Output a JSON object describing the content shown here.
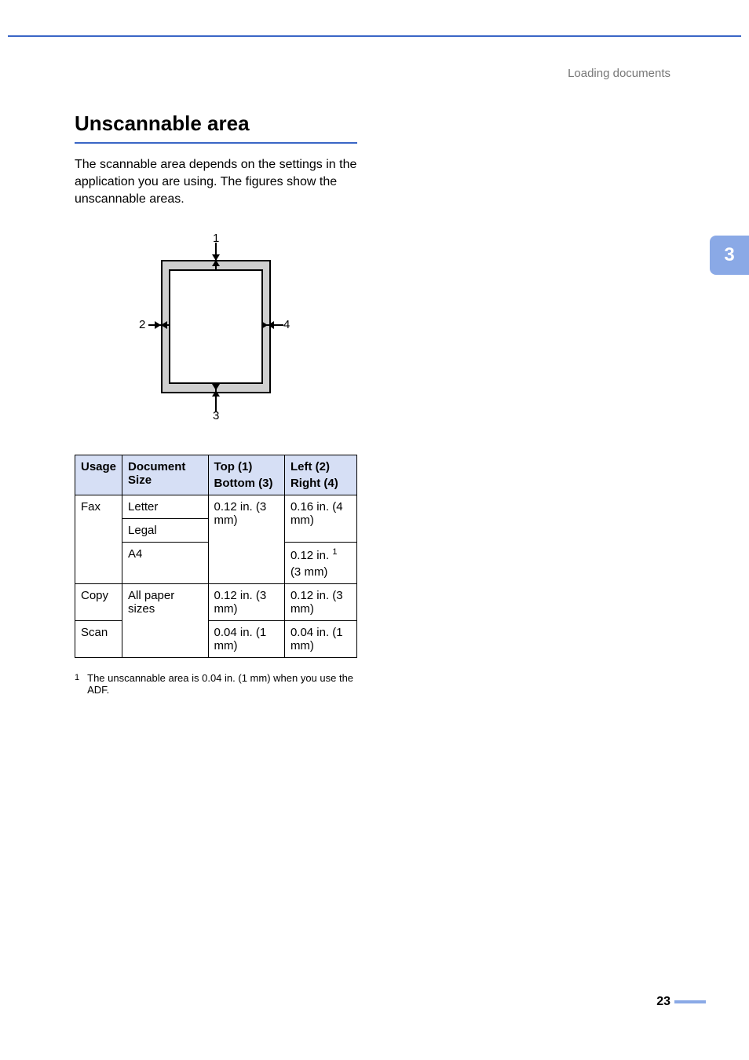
{
  "breadcrumb": "Loading documents",
  "tab_number": "3",
  "heading": "Unscannable area",
  "intro": "The scannable area depends on the settings in the application you are using. The figures show the unscannable areas.",
  "diagram": {
    "label1": "1",
    "label2": "2",
    "label3": "3",
    "label4": "4"
  },
  "table": {
    "headers": {
      "usage": "Usage",
      "doc_size": "Document Size",
      "top": "Top (1)",
      "bottom": "Bottom (3)",
      "left": "Left (2)",
      "right": "Right (4)"
    },
    "rows": {
      "fax": {
        "usage": "Fax",
        "size_letter": "Letter",
        "size_legal": "Legal",
        "size_a4": "A4",
        "top_bottom": "0.12 in. (3 mm)",
        "lr_letter_legal": "0.16 in. (4 mm)",
        "lr_a4_line1": "0.12 in.",
        "lr_a4_sup": "1",
        "lr_a4_line2": "(3 mm)"
      },
      "copy": {
        "usage": "Copy",
        "size": "All paper sizes",
        "top_bottom": "0.12 in. (3 mm)",
        "lr": "0.12 in. (3 mm)"
      },
      "scan": {
        "usage": "Scan",
        "top_bottom": "0.04 in. (1 mm)",
        "lr": "0.04 in. (1 mm)"
      }
    }
  },
  "footnote": {
    "num": "1",
    "text": "The unscannable area is 0.04 in. (1 mm) when you use the ADF."
  },
  "page_number": "23"
}
